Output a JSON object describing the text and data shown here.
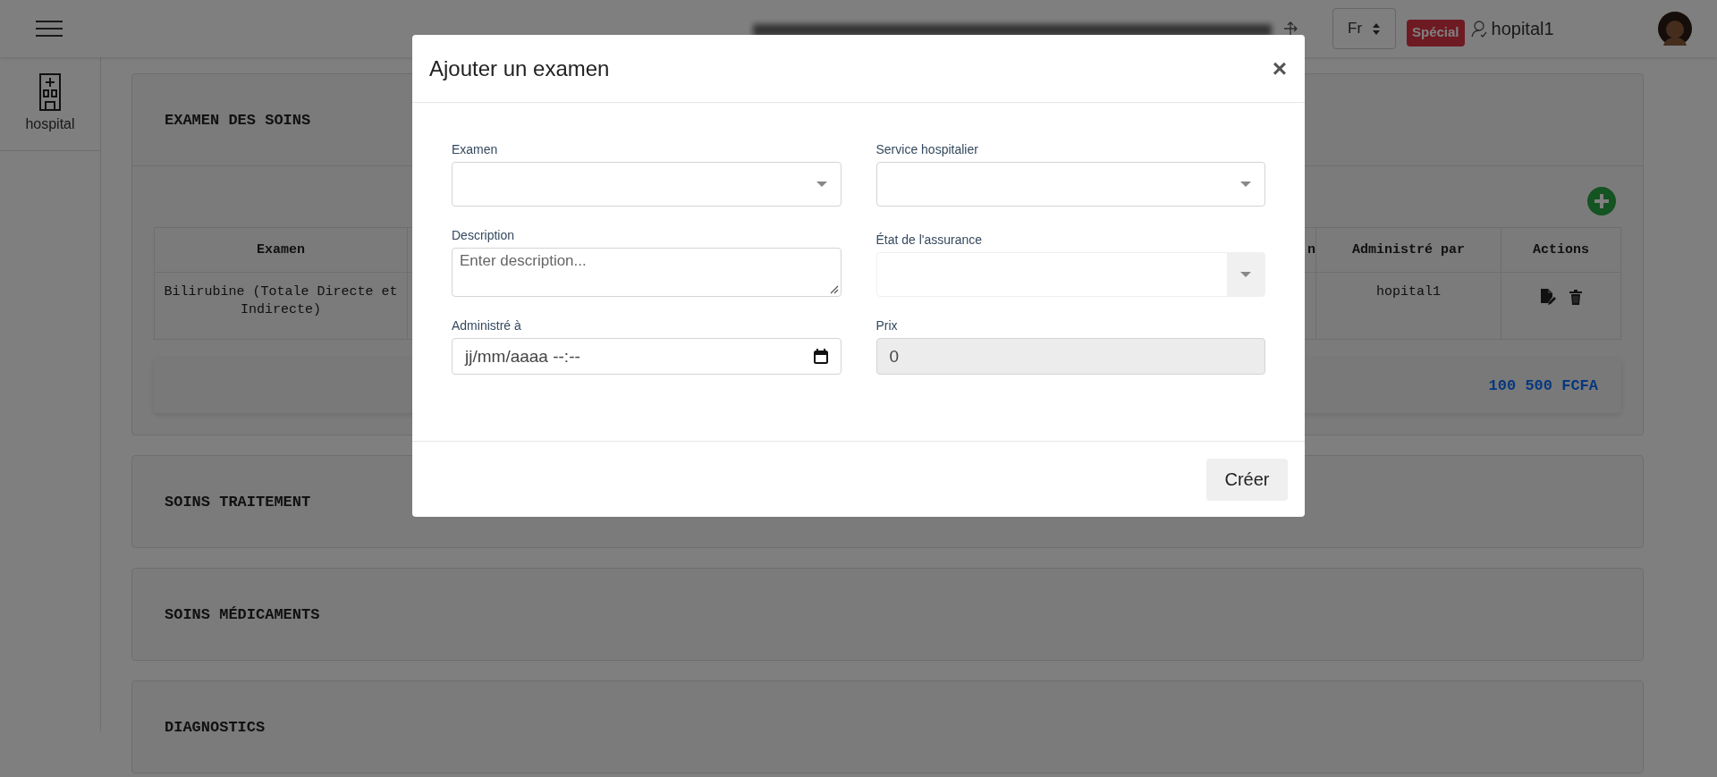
{
  "topbar": {
    "language": "Fr",
    "badge": "Spécial",
    "username": "hopital1"
  },
  "sidebar": {
    "items": [
      {
        "label": "hospital"
      }
    ]
  },
  "sections": [
    {
      "title": "EXAMEN DES SOINS",
      "expanded": true,
      "table": {
        "columns": [
          "Examen",
          "n",
          "Administré par",
          "Actions"
        ],
        "rows": [
          {
            "examen": "Bilirubine (Totale Directe et Indirecte)",
            "administered_by": "hopital1"
          }
        ]
      },
      "total": "100 500 FCFA"
    },
    {
      "title": "SOINS TRAITEMENT",
      "expanded": false
    },
    {
      "title": "SOINS MÉDICAMENTS",
      "expanded": false
    },
    {
      "title": "DIAGNOSTICS",
      "expanded": false
    }
  ],
  "modal": {
    "title": "Ajouter un examen",
    "close": "×",
    "fields": [
      {
        "label": "Examen",
        "kind": "select",
        "disabled": false
      },
      {
        "label": "Service hospitalier",
        "kind": "select",
        "disabled": false
      },
      {
        "label": "Description",
        "kind": "textarea",
        "placeholder": "Enter description..."
      },
      {
        "label": "État de l'assurance",
        "kind": "select",
        "disabled": true
      },
      {
        "label": "Administré à",
        "kind": "datetime",
        "value": "jj/mm/aaaa --:--"
      },
      {
        "label": "Prix",
        "kind": "number",
        "value": "0",
        "disabled": true
      }
    ],
    "submit": "Créer"
  }
}
